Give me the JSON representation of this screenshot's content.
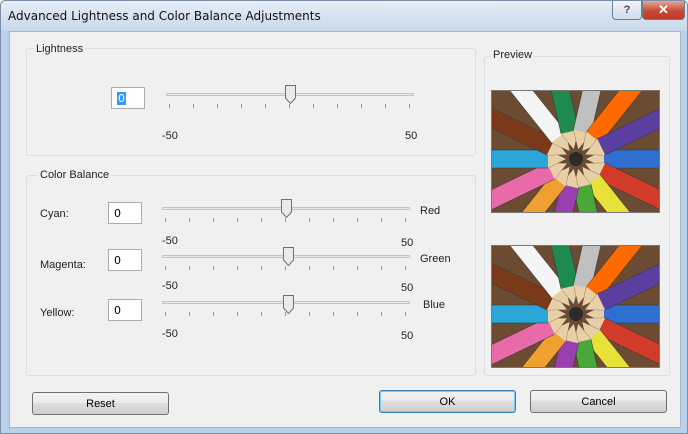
{
  "window": {
    "title": "Advanced Lightness and Color Balance Adjustments",
    "help_label": "?",
    "close_label": "✕"
  },
  "lightness": {
    "group_label": "Lightness",
    "value": "0",
    "min_label": "-50",
    "max_label": "50",
    "slider_value": 0
  },
  "color_balance": {
    "group_label": "Color Balance",
    "rows": [
      {
        "left": "Cyan:",
        "value": "0",
        "right": "Red",
        "min_label": "-50",
        "max_label": "50",
        "slider_value": 0
      },
      {
        "left": "Magenta:",
        "value": "0",
        "right": "Green",
        "min_label": "-50",
        "max_label": "50",
        "slider_value": 0
      },
      {
        "left": "Yellow:",
        "value": "0",
        "right": "Blue",
        "min_label": "-50",
        "max_label": "50",
        "slider_value": 0
      }
    ]
  },
  "preview": {
    "group_label": "Preview"
  },
  "buttons": {
    "reset": "Reset",
    "ok": "OK",
    "cancel": "Cancel"
  }
}
